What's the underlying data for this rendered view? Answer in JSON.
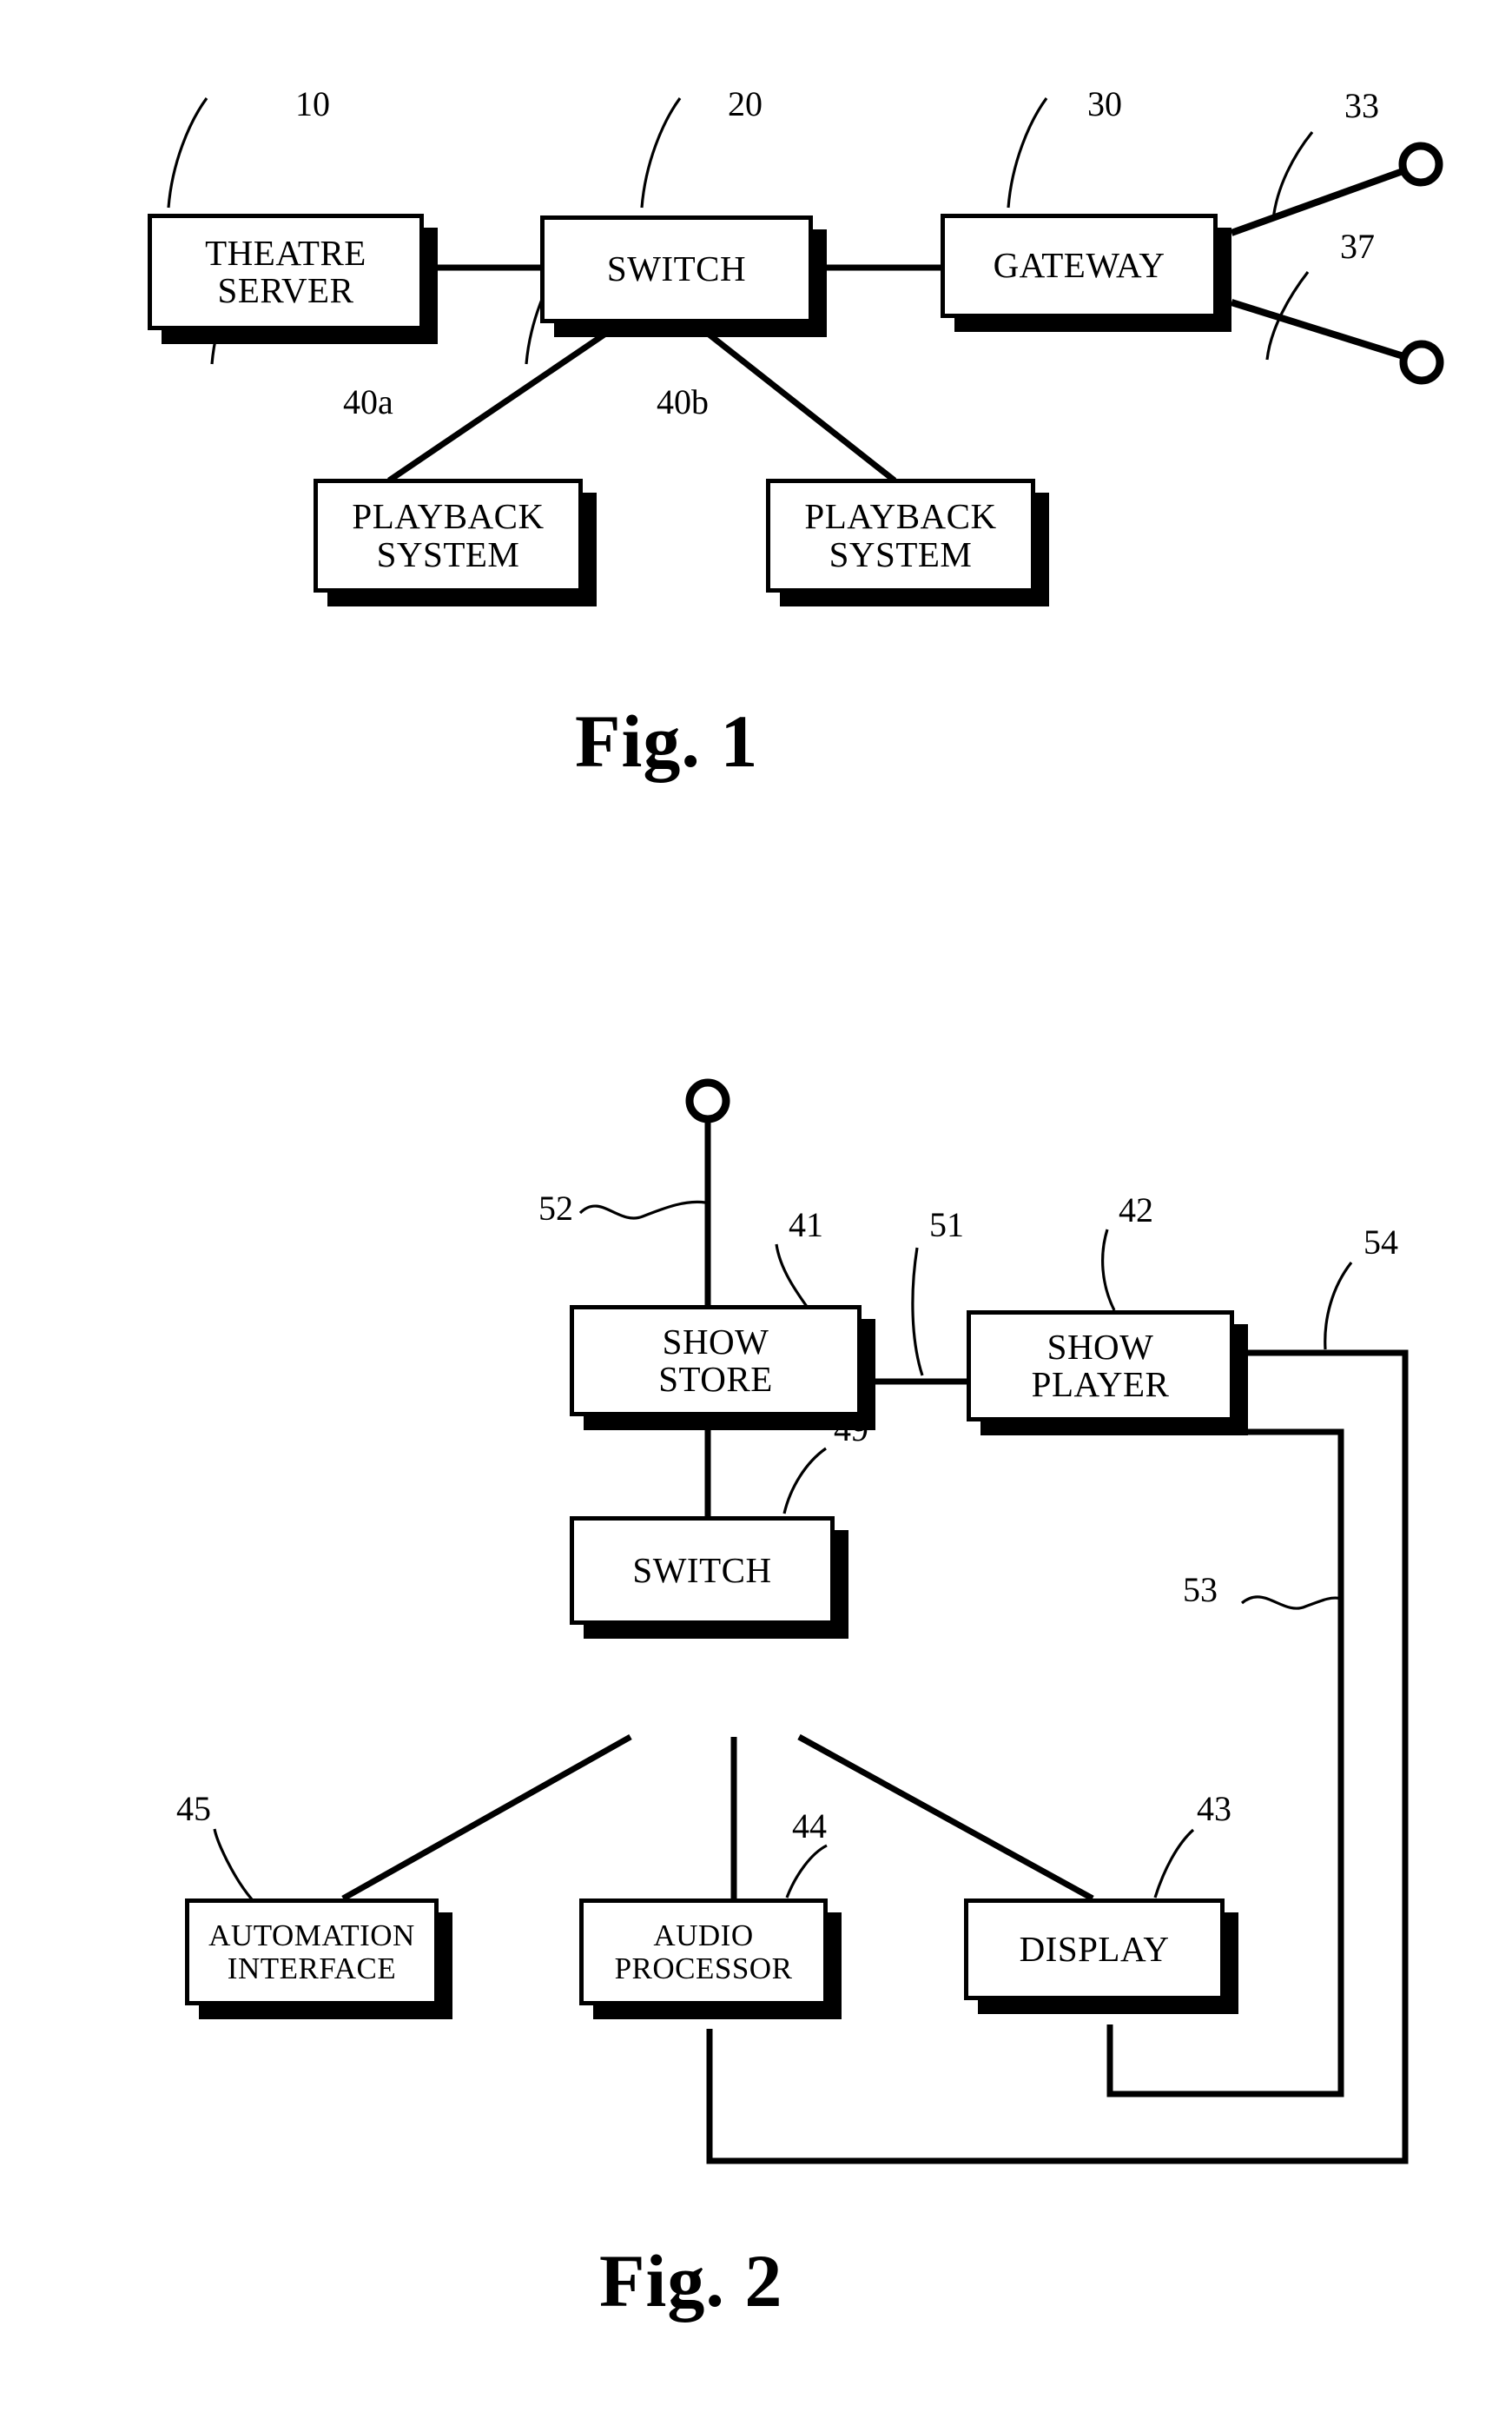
{
  "document": {
    "type": "patent-drawing-sheet",
    "figures": [
      {
        "id": "fig1",
        "caption": "Fig. 1",
        "nodes": [
          {
            "id": "theatre-server",
            "lines": [
              "THEATRE",
              "SERVER"
            ],
            "ref": "10"
          },
          {
            "id": "switch",
            "lines": [
              "SWITCH"
            ],
            "ref": "20"
          },
          {
            "id": "gateway",
            "lines": [
              "GATEWAY"
            ],
            "ref": "30"
          },
          {
            "id": "playback-system-a",
            "lines": [
              "PLAYBACK",
              "SYSTEM"
            ],
            "ref": "40a"
          },
          {
            "id": "playback-system-b",
            "lines": [
              "PLAYBACK",
              "SYSTEM"
            ],
            "ref": "40b"
          }
        ],
        "link_refs": [
          {
            "id": "link-33",
            "ref": "33"
          },
          {
            "id": "link-37",
            "ref": "37"
          }
        ]
      },
      {
        "id": "fig2",
        "caption": "Fig. 2",
        "nodes": [
          {
            "id": "show-store",
            "lines": [
              "SHOW",
              "STORE"
            ],
            "ref": "41"
          },
          {
            "id": "show-player",
            "lines": [
              "SHOW",
              "PLAYER"
            ],
            "ref": "42"
          },
          {
            "id": "switch",
            "lines": [
              "SWITCH"
            ],
            "ref": "49"
          },
          {
            "id": "automation-interface",
            "lines": [
              "AUTOMATION",
              "INTERFACE"
            ],
            "ref": "45"
          },
          {
            "id": "audio-processor",
            "lines": [
              "AUDIO",
              "PROCESSOR"
            ],
            "ref": "44"
          },
          {
            "id": "display",
            "lines": [
              "DISPLAY"
            ],
            "ref": "43"
          }
        ],
        "link_refs": [
          {
            "id": "link-52",
            "ref": "52"
          },
          {
            "id": "link-51",
            "ref": "51"
          },
          {
            "id": "link-54",
            "ref": "54"
          },
          {
            "id": "link-53",
            "ref": "53"
          }
        ]
      }
    ],
    "colors": {
      "ink": "#000000",
      "paper": "#ffffff"
    }
  }
}
